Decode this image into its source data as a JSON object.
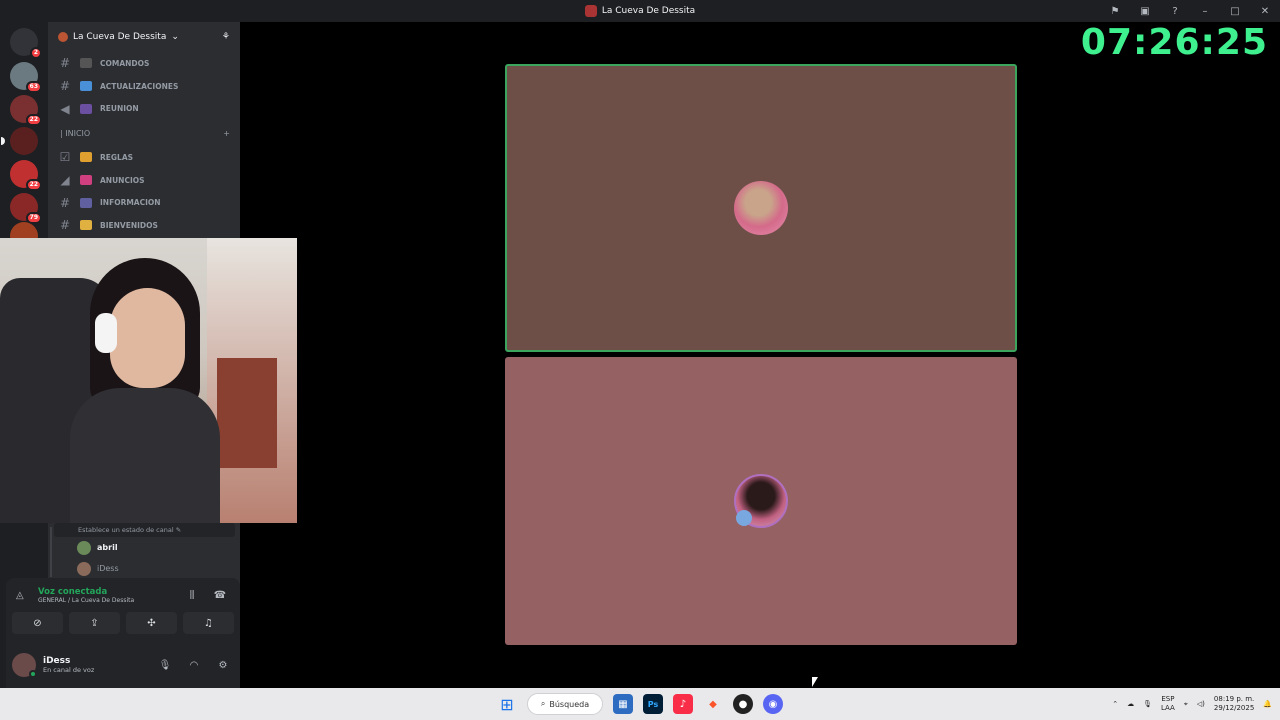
{
  "window": {
    "title": "La Cueva De Dessita"
  },
  "clock": "07:26:25",
  "guilds": [
    {
      "badge": "2"
    },
    {
      "badge": "63"
    },
    {
      "badge": "22"
    },
    {
      "badge": ""
    },
    {
      "badge": "22"
    },
    {
      "badge": "79"
    },
    {
      "badge": ""
    }
  ],
  "server": {
    "name": "La Cueva De Dessita"
  },
  "channels_top": [
    {
      "name": "COMANDOS",
      "icon": "#",
      "emoji_color": "#444"
    },
    {
      "name": "ACTUALIZACIONES",
      "icon": "#",
      "emoji_color": "#4a90d9"
    },
    {
      "name": "REUNION",
      "icon": "speaker",
      "emoji_color": "#6b4fa0"
    }
  ],
  "category": {
    "name": "| INICIO"
  },
  "channels_inicio": [
    {
      "name": "REGLAS",
      "icon": "rules",
      "emoji_color": "#e0a030"
    },
    {
      "name": "ANUNCIOS",
      "icon": "megaphone",
      "emoji_color": "#d04080"
    },
    {
      "name": "INFORMACION",
      "icon": "#",
      "emoji_color": "#6060a0"
    },
    {
      "name": "BIENVENIDOS",
      "icon": "#",
      "emoji_color": "#e0b040"
    }
  ],
  "voice": {
    "status_placeholder": "Establece un estado de canal",
    "users": [
      {
        "name": "abril"
      },
      {
        "name": "iDess"
      }
    ]
  },
  "rtc": {
    "title": "Voz conectada",
    "subtitle": "GENERAL / La Cueva De Dessita"
  },
  "user": {
    "name": "iDess",
    "status": "En canal de voz"
  },
  "taskbar": {
    "search_label": "Búsqueda"
  },
  "tray": {
    "lang1": "ESP",
    "lang2": "LAA",
    "time": "08:19 p. m.",
    "date": "29/12/2025"
  },
  "colors": {
    "clock": "#3ff08e",
    "speaking": "#3ba55d",
    "tile1": "#6e4f48",
    "tile2": "#956162"
  }
}
